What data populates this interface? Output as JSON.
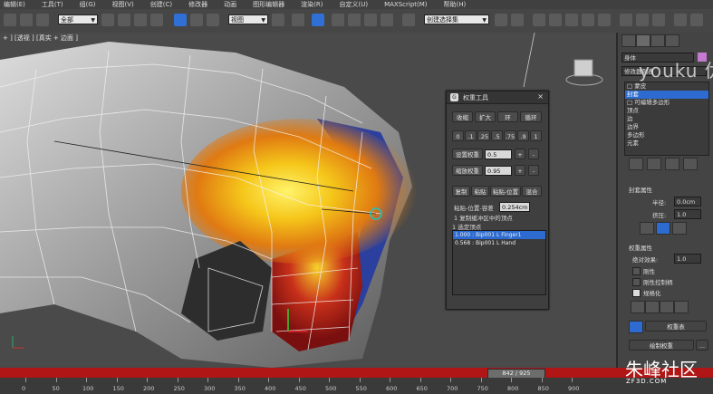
{
  "menu": [
    "编辑(E)",
    "工具(T)",
    "组(G)",
    "视图(V)",
    "创建(C)",
    "修改器",
    "动画",
    "图形编辑器",
    "渲染(R)",
    "自定义(U)",
    "MAXScript(M)",
    "帮助(H)"
  ],
  "toolbar": {
    "selection_filter": "全部",
    "reference_coord": "视图",
    "named_selection": "创建选择集"
  },
  "viewport": {
    "label": "+ ] [透视 ] [真实 + 边面 ]"
  },
  "weight_tool": {
    "title": "权重工具",
    "close": "×",
    "row1": [
      "收缩",
      "扩大",
      "环",
      "循环"
    ],
    "presets": [
      "0",
      ".1",
      ".25",
      ".5",
      ".75",
      ".9",
      "1"
    ],
    "set_weight_label": "设置权重",
    "set_weight_value": "0.5",
    "scale_weight_label": "缩放权重",
    "scale_weight_value": "0.95",
    "row_copy": [
      "复制",
      "粘贴",
      "粘贴-位置",
      "混合"
    ],
    "paste_tolerance_label": "粘贴-位置-容差",
    "paste_tolerance_value": "0.254cm",
    "copy_buffer_text": "1 复制缓冲区中的顶点",
    "selected_vertices_text": "1 选定顶点",
    "weights": [
      {
        "text": "1.000 : Bip001 L Finger1",
        "selected": true
      },
      {
        "text": "0.568 : Bip001 L Hand",
        "selected": false
      }
    ]
  },
  "panel": {
    "object_name": "身体",
    "modifier_list": "修改器列表",
    "stack": [
      {
        "text": "□ 蒙皮",
        "selected": false
      },
      {
        "text": "  封套",
        "selected": true
      },
      {
        "text": "□ 可编辑多边形",
        "selected": false
      },
      {
        "text": "  顶点",
        "selected": false
      },
      {
        "text": "  边",
        "selected": false
      },
      {
        "text": "  边界",
        "selected": false
      },
      {
        "text": "  多边形",
        "selected": false
      },
      {
        "text": "  元素",
        "selected": false
      }
    ],
    "envelope_props": "封套属性",
    "radius_label": "半径:",
    "radius_value": "0.0cm",
    "squash_label": "挤压:",
    "squash_value": "1.0",
    "weight_props": "权重属性",
    "abs_effect_label": "绝对效果:",
    "abs_effect_value": "1.0",
    "rigid": "刚性",
    "rigid_handles": "刚性控制柄",
    "normalize": "规格化",
    "weight_table": "权重表",
    "paint_weights": "绘制权重",
    "paint_options": "..."
  },
  "timeline": {
    "frame": "842 / 925",
    "ticks": [
      "0",
      "50",
      "100",
      "150",
      "200",
      "250",
      "300",
      "350",
      "400",
      "450",
      "500",
      "550",
      "600",
      "650",
      "700",
      "750",
      "800",
      "850",
      "900"
    ]
  },
  "watermarks": {
    "youku": "youku 优酷",
    "site_name": "朱峰社区",
    "site_url": "ZF3D.COM"
  }
}
